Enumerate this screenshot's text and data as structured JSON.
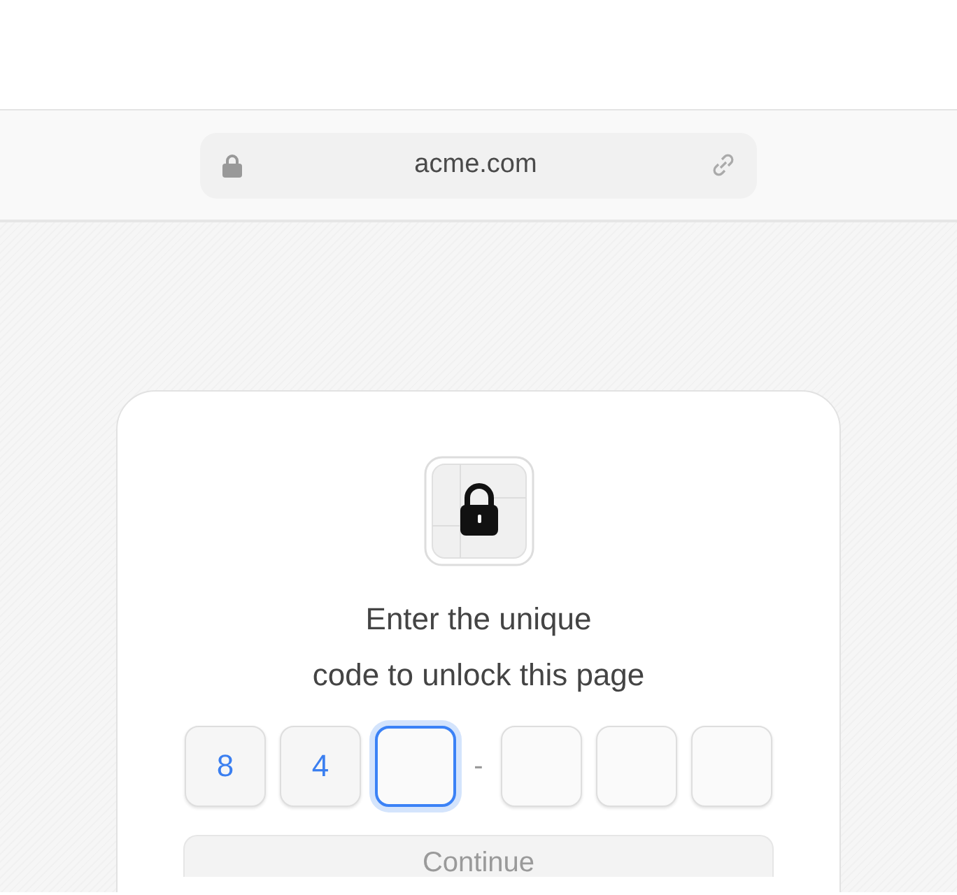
{
  "address_bar": {
    "url": "acme.com"
  },
  "unlock_card": {
    "heading_lines": [
      "Enter the unique",
      "code to unlock this page"
    ],
    "code_cells": [
      {
        "value": "8",
        "focused": false
      },
      {
        "value": "4",
        "focused": false
      },
      {
        "focused": true
      },
      {
        "kind": "separator",
        "value": "-"
      },
      {
        "focused": false
      },
      {
        "focused": false
      },
      {
        "focused": false
      }
    ],
    "button": {
      "label": "Continue",
      "disabled": true
    }
  }
}
